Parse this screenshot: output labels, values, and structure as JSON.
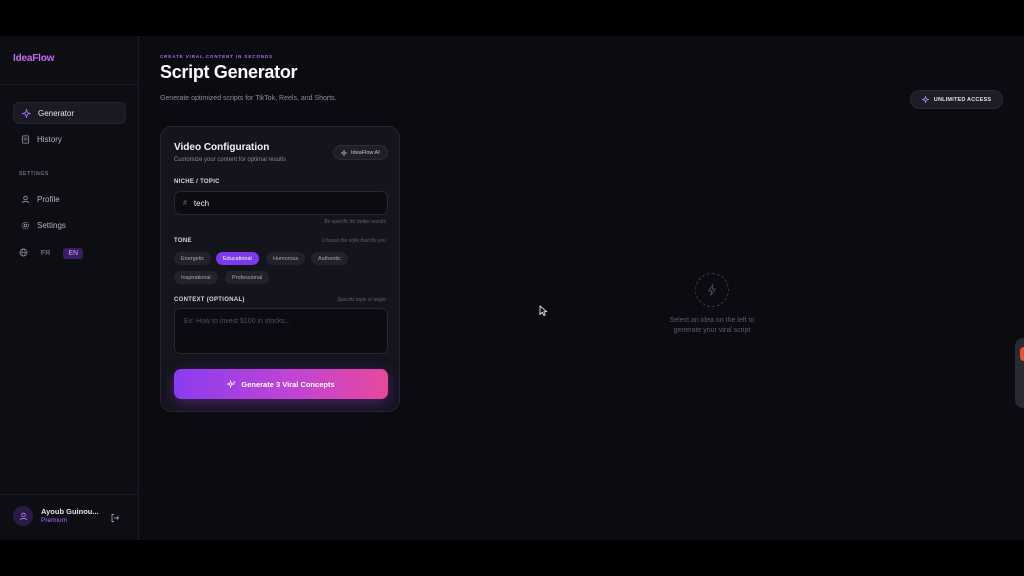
{
  "sidebar": {
    "logo": "IdeaFlow",
    "nav": [
      {
        "label": "Generator",
        "icon": "sparkle-icon",
        "active": true
      },
      {
        "label": "History",
        "icon": "history-icon",
        "active": false
      }
    ],
    "settings_label": "SETTINGS",
    "settings_items": [
      {
        "label": "Profile",
        "icon": "user-icon"
      },
      {
        "label": "Settings",
        "icon": "gear-icon"
      }
    ],
    "languages": [
      "FR",
      "EN"
    ],
    "active_language": "EN",
    "user": {
      "name": "Ayoub Guinou...",
      "plan": "Premium"
    }
  },
  "header": {
    "eyebrow": "CREATE VIRAL CONTENT IN SECONDS",
    "title": "Script Generator",
    "subtitle": "Generate optimized scripts for TikTok, Reels, and Shorts.",
    "access_label": "UNLIMITED ACCESS"
  },
  "card": {
    "title": "Video Configuration",
    "subtitle": "Customize your content for optimal results",
    "badge": "IdeaFlow AI",
    "niche_label": "NICHE / TOPIC",
    "niche_value": "tech",
    "niche_hint": "Be specific for better results",
    "tone_label": "TONE",
    "tone_hint": "Choose the style that fits you",
    "tones": [
      "Energetic",
      "Educational",
      "Humorous",
      "Authentic",
      "Inspirational",
      "Professional"
    ],
    "selected_tone": "Educational",
    "context_label": "CONTEXT (OPTIONAL)",
    "context_hint": "Specific topic or angle",
    "context_placeholder": "Ex: How to invest $100 in stocks...",
    "generate_label": "Generate 3 Viral Concepts"
  },
  "empty_state": {
    "line1": "Select an idea on the left to",
    "line2": "generate your viral script"
  },
  "colors": {
    "accent": "#7c3aed",
    "brand_gradient_start": "#8a3cf0",
    "brand_gradient_end": "#e8489c",
    "background": "#0b0b12"
  }
}
